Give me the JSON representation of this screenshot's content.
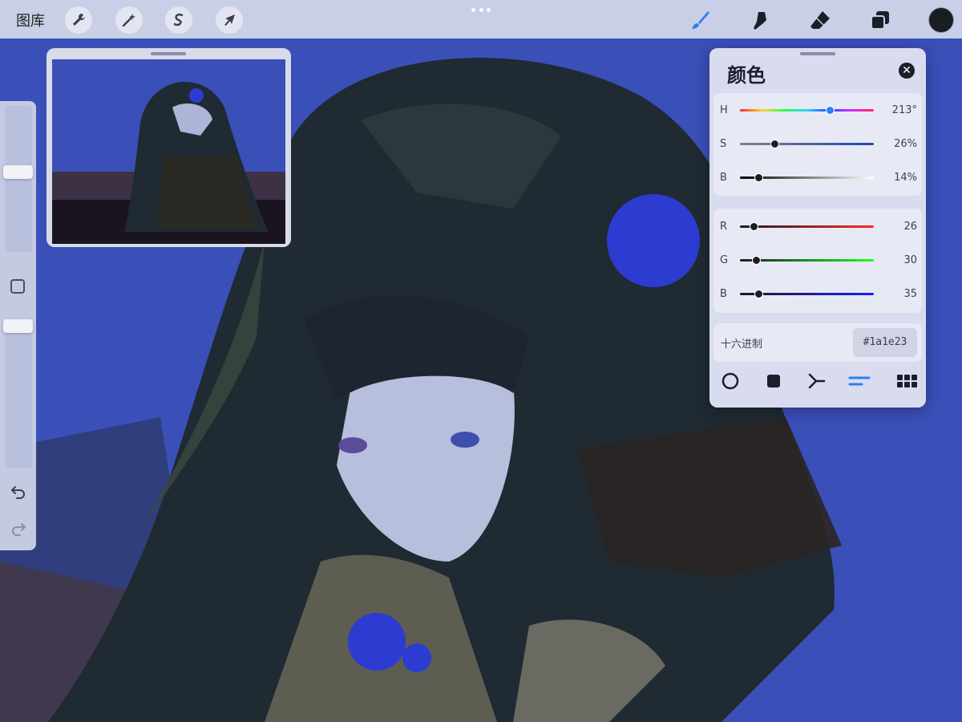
{
  "topbar": {
    "gallery_label": "图库",
    "left_tools": [
      "wrench-icon",
      "magic-wand-icon",
      "selection-s-icon",
      "arrow-cursor-icon"
    ],
    "right_tools": [
      "brush-icon",
      "smudge-icon",
      "eraser-icon",
      "layers-icon"
    ],
    "current_color": "#1a1e23"
  },
  "sidebar": {
    "brush_size_level": 0.55,
    "opacity_level": 1.0,
    "undo_icon": "undo-icon",
    "redo_icon": "redo-icon"
  },
  "color_panel": {
    "title": "颜色",
    "hsb": [
      {
        "label": "H",
        "value": "213°",
        "fraction": 0.67
      },
      {
        "label": "S",
        "value": "26%",
        "fraction": 0.26
      },
      {
        "label": "B",
        "value": "14%",
        "fraction": 0.14
      }
    ],
    "rgb": [
      {
        "label": "R",
        "value": "26",
        "fraction": 0.1
      },
      {
        "label": "G",
        "value": "30",
        "fraction": 0.12
      },
      {
        "label": "B",
        "value": "35",
        "fraction": 0.14
      }
    ],
    "hex_label": "十六进制",
    "hex_value": "#1a1e23",
    "modes": [
      "disc-icon",
      "classic-square-icon",
      "harmony-icon",
      "value-sliders-icon",
      "palette-grid-icon"
    ],
    "active_mode": "value-sliders-icon"
  },
  "colors": {
    "canvas_bg": "#3a4fb8",
    "accent_blue": "#2f7ff0"
  }
}
